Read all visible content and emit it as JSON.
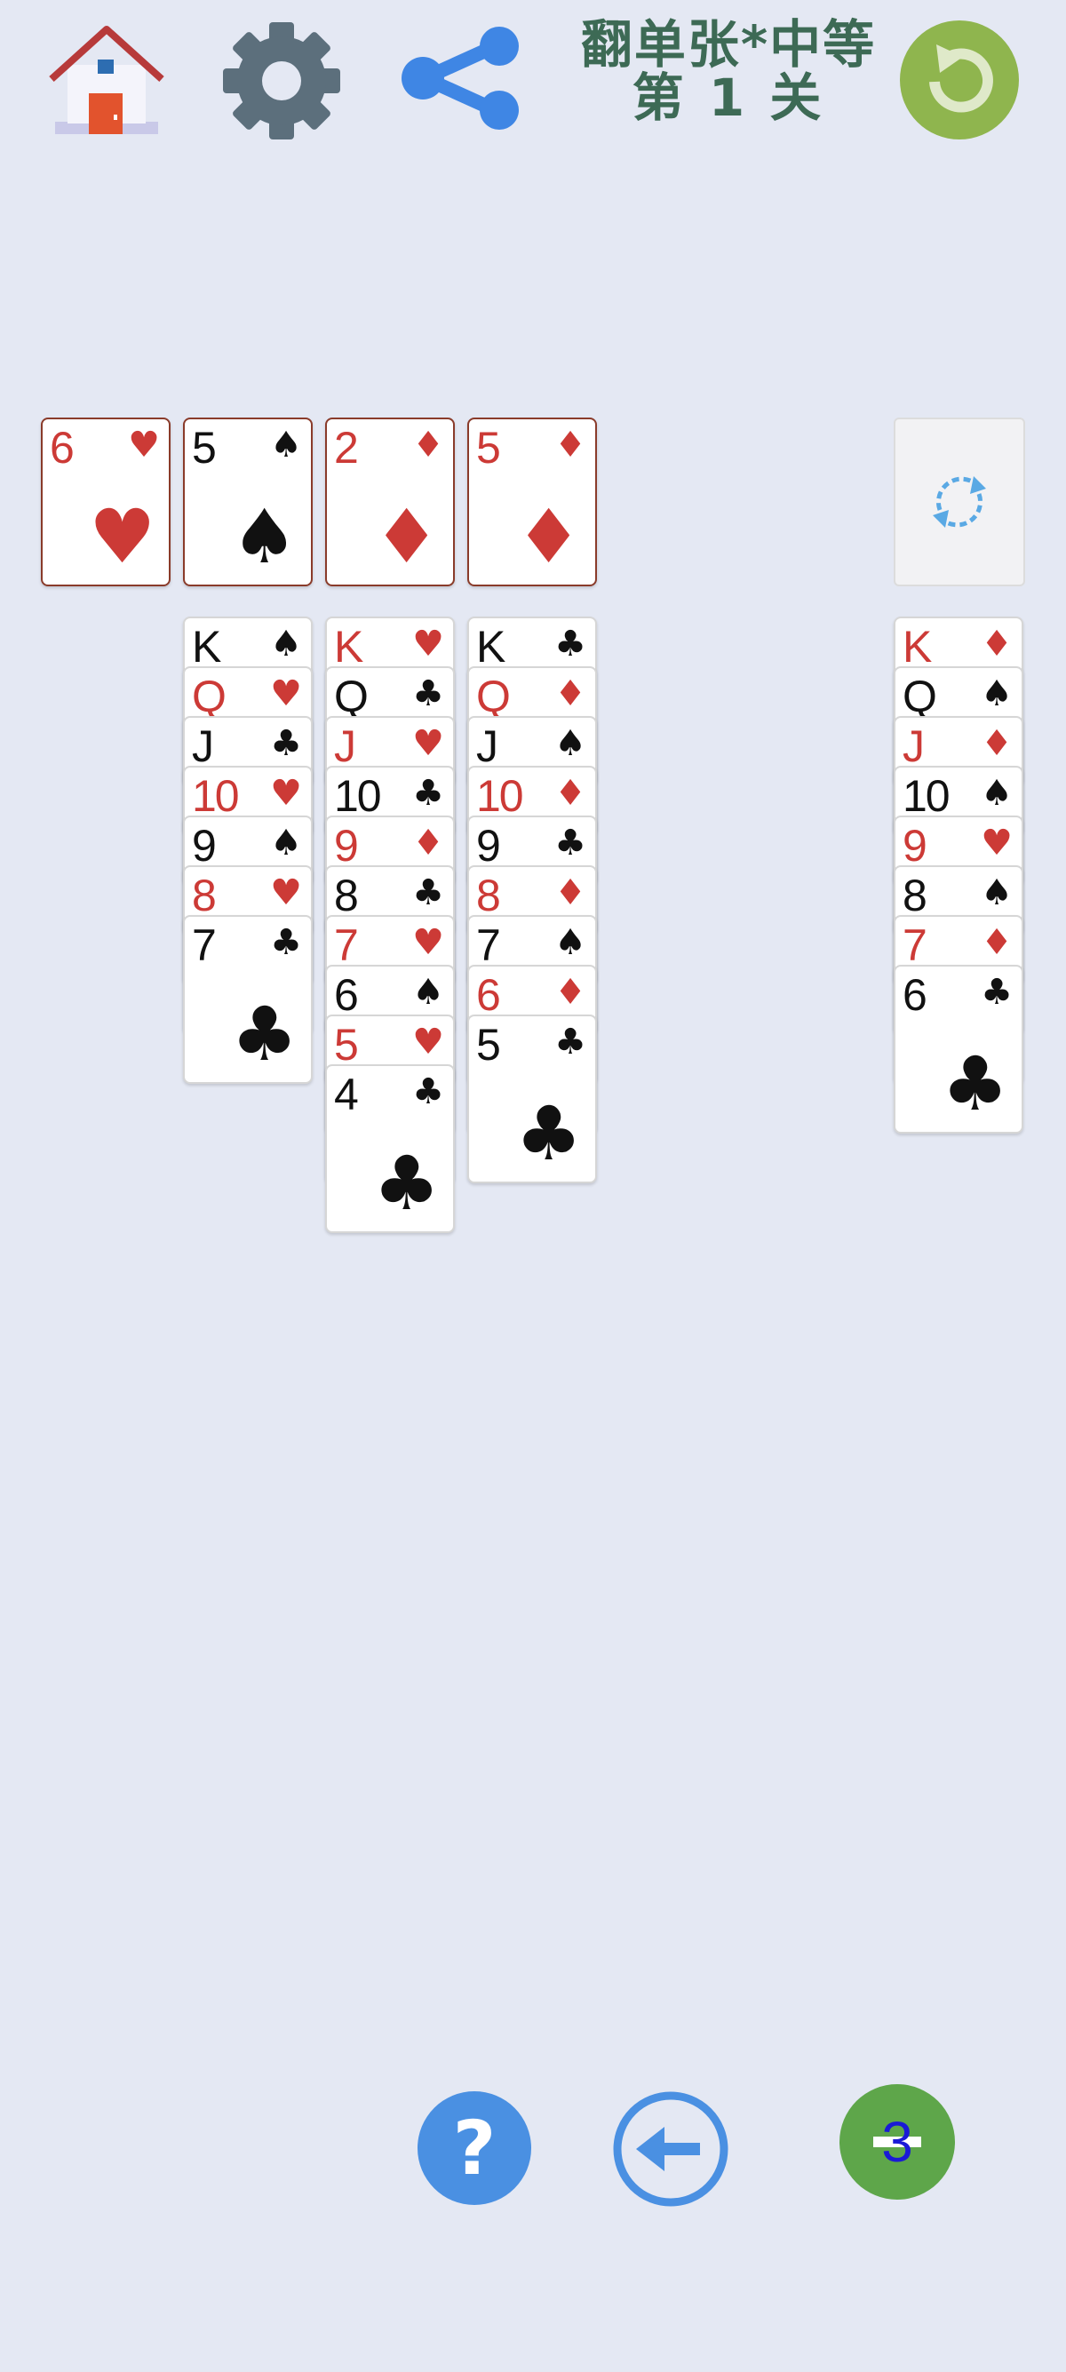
{
  "header": {
    "title_line1": "翻单张*中等",
    "title_line2": "第 1 关",
    "home_icon": "home-icon",
    "settings_icon": "gear-icon",
    "share_icon": "share-icon",
    "restart_icon": "restart-icon"
  },
  "colors": {
    "background": "#e4e8f3",
    "red_suit": "#cc3a36",
    "black_suit": "#111111",
    "title": "#3d6a55",
    "restart_button": "#8fb54e",
    "help_button": "#4a90e2",
    "hint_button": "#5ea64a"
  },
  "foundations": [
    {
      "rank": "6",
      "suit": "♥",
      "color": "red"
    },
    {
      "rank": "5",
      "suit": "♠",
      "color": "black"
    },
    {
      "rank": "2",
      "suit": "♦",
      "color": "red"
    },
    {
      "rank": "5",
      "suit": "♦",
      "color": "red"
    }
  ],
  "stock": {
    "icon": "recycle-icon"
  },
  "tableau": [
    [],
    [
      {
        "rank": "K",
        "suit": "♠",
        "color": "black"
      },
      {
        "rank": "Q",
        "suit": "♥",
        "color": "red"
      },
      {
        "rank": "J",
        "suit": "♣",
        "color": "black"
      },
      {
        "rank": "10",
        "suit": "♥",
        "color": "red"
      },
      {
        "rank": "9",
        "suit": "♠",
        "color": "black"
      },
      {
        "rank": "8",
        "suit": "♥",
        "color": "red"
      },
      {
        "rank": "7",
        "suit": "♣",
        "color": "black"
      }
    ],
    [
      {
        "rank": "K",
        "suit": "♥",
        "color": "red"
      },
      {
        "rank": "Q",
        "suit": "♣",
        "color": "black"
      },
      {
        "rank": "J",
        "suit": "♥",
        "color": "red"
      },
      {
        "rank": "10",
        "suit": "♣",
        "color": "black"
      },
      {
        "rank": "9",
        "suit": "♦",
        "color": "red"
      },
      {
        "rank": "8",
        "suit": "♣",
        "color": "black"
      },
      {
        "rank": "7",
        "suit": "♥",
        "color": "red"
      },
      {
        "rank": "6",
        "suit": "♠",
        "color": "black"
      },
      {
        "rank": "5",
        "suit": "♥",
        "color": "red"
      },
      {
        "rank": "4",
        "suit": "♣",
        "color": "black"
      }
    ],
    [
      {
        "rank": "K",
        "suit": "♣",
        "color": "black"
      },
      {
        "rank": "Q",
        "suit": "♦",
        "color": "red"
      },
      {
        "rank": "J",
        "suit": "♠",
        "color": "black"
      },
      {
        "rank": "10",
        "suit": "♦",
        "color": "red"
      },
      {
        "rank": "9",
        "suit": "♣",
        "color": "black"
      },
      {
        "rank": "8",
        "suit": "♦",
        "color": "red"
      },
      {
        "rank": "7",
        "suit": "♠",
        "color": "black"
      },
      {
        "rank": "6",
        "suit": "♦",
        "color": "red"
      },
      {
        "rank": "5",
        "suit": "♣",
        "color": "black"
      }
    ],
    [],
    [],
    [
      {
        "rank": "K",
        "suit": "♦",
        "color": "red"
      },
      {
        "rank": "Q",
        "suit": "♠",
        "color": "black"
      },
      {
        "rank": "J",
        "suit": "♦",
        "color": "red"
      },
      {
        "rank": "10",
        "suit": "♠",
        "color": "black"
      },
      {
        "rank": "9",
        "suit": "♥",
        "color": "red"
      },
      {
        "rank": "8",
        "suit": "♠",
        "color": "black"
      },
      {
        "rank": "7",
        "suit": "♦",
        "color": "red"
      },
      {
        "rank": "6",
        "suit": "♣",
        "color": "black"
      }
    ]
  ],
  "bottom": {
    "help_label": "?",
    "undo_icon": "undo-arrow-icon",
    "hint_count": "3"
  }
}
